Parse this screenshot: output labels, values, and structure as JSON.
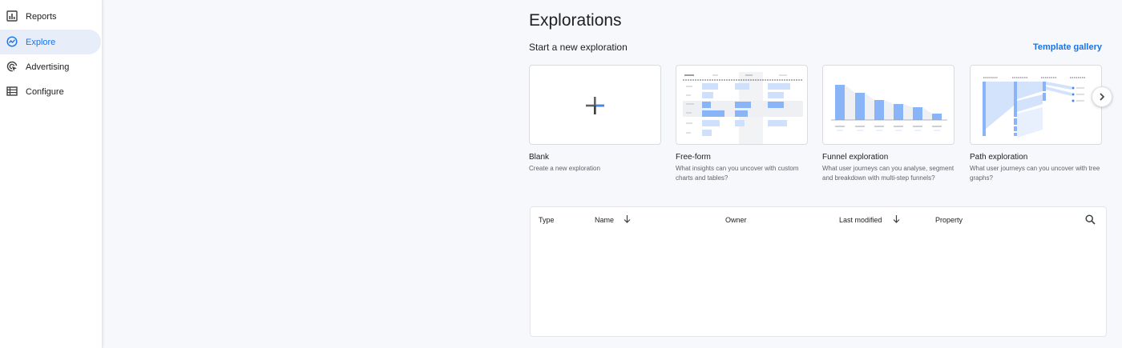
{
  "sidebar": {
    "items": [
      {
        "label": "Reports",
        "icon": "bar-chart-icon",
        "active": false
      },
      {
        "label": "Explore",
        "icon": "explore-icon",
        "active": true
      },
      {
        "label": "Advertising",
        "icon": "advertising-icon",
        "active": false
      },
      {
        "label": "Configure",
        "icon": "list-icon",
        "active": false
      }
    ]
  },
  "main": {
    "title": "Explorations",
    "section_title": "Start a new exploration",
    "template_gallery": "Template gallery",
    "cards": [
      {
        "title": "Blank",
        "description": "Create a new exploration",
        "icon": "plus-icon"
      },
      {
        "title": "Free-form",
        "description": "What insights can you uncover with custom charts and tables?"
      },
      {
        "title": "Funnel exploration",
        "description": "What user journeys can you analyse, segment and breakdown with multi-step funnels?"
      },
      {
        "title": "Path exploration",
        "description": "What user journeys can you uncover with tree graphs?"
      }
    ],
    "next_icon": "chevron-right-icon"
  },
  "table": {
    "columns": {
      "type": "Type",
      "name": "Name",
      "owner": "Owner",
      "last_modified": "Last modified",
      "property": "Property"
    },
    "rows": []
  },
  "colors": {
    "accent": "#1a73e8",
    "active_bg": "#e8eef9",
    "chart_blue": "#8ab4f8"
  }
}
